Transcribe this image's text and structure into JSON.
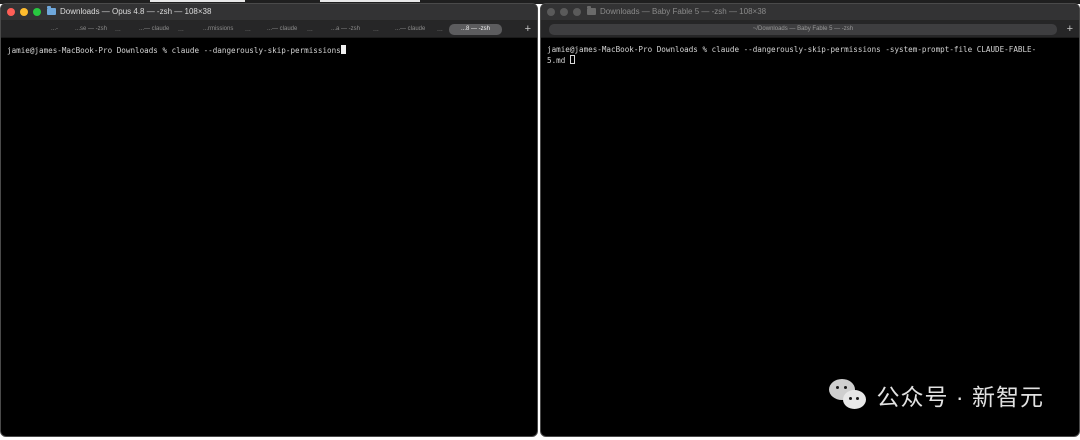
{
  "left_window": {
    "title": "Downloads — Opus 4.8 — -zsh — 108×38",
    "tabs": [
      {
        "label": "...-",
        "active": false
      },
      {
        "label": "...se — -zsh",
        "active": false
      },
      {
        "label": "...— claude",
        "active": false
      },
      {
        "label": "...rmissions",
        "active": false
      },
      {
        "label": "...— claude",
        "active": false
      },
      {
        "label": "...a — -zsh",
        "active": false
      },
      {
        "label": "...— claude",
        "active": false
      },
      {
        "label": "...8 — -zsh",
        "active": true
      }
    ],
    "tab_separator": "...",
    "new_tab": "+",
    "terminal_line": "jamie@james-MacBook-Pro Downloads % claude --dangerously-skip-permissions"
  },
  "right_window": {
    "title": "Downloads — Baby Fable 5 — -zsh — 108×38",
    "tab": "~/Downloads — Baby Fable 5 — -zsh",
    "new_tab": "+",
    "terminal_line1": "jamie@james-MacBook-Pro Downloads % claude --dangerously-skip-permissions -system-prompt-file CLAUDE-FABLE-",
    "terminal_line2": "5.md "
  },
  "watermark": {
    "text": "公众号 · 新智元",
    "icon": "wechat-icon"
  }
}
